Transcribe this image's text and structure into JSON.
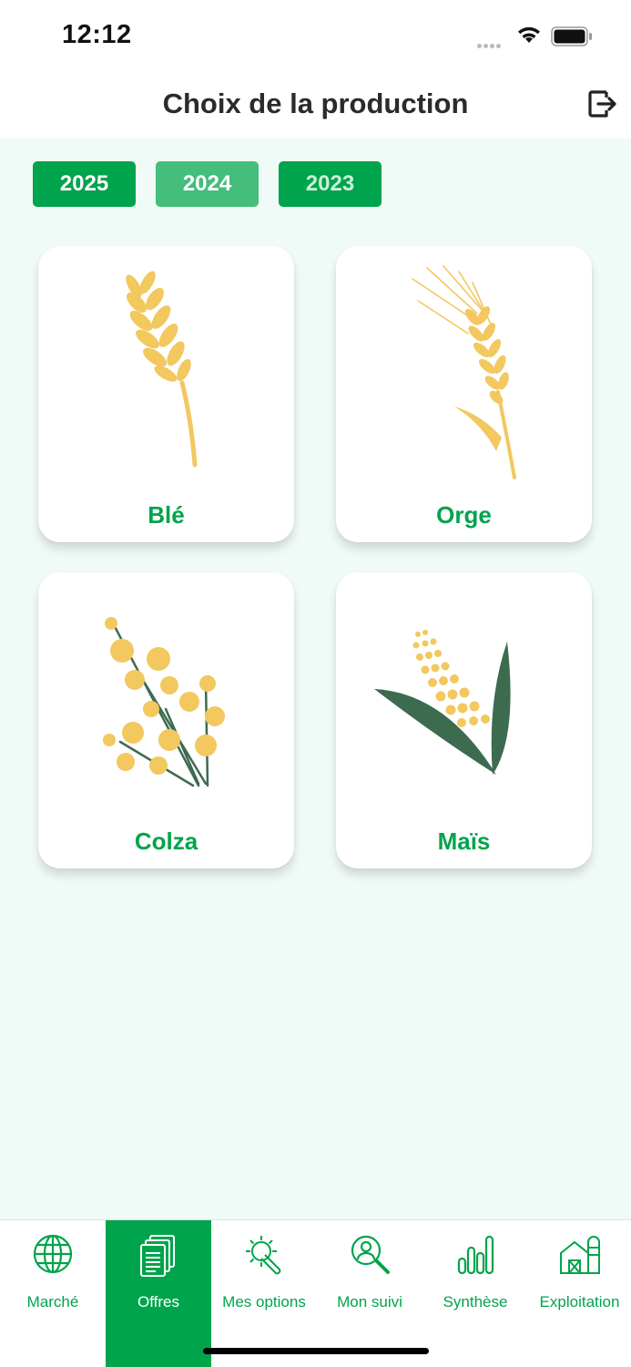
{
  "status": {
    "time": "12:12"
  },
  "header": {
    "title": "Choix de la production"
  },
  "years": [
    "2025",
    "2024",
    "2023"
  ],
  "selected_year": "2024",
  "crops": [
    {
      "label": "Blé",
      "icon": "wheat-icon"
    },
    {
      "label": "Orge",
      "icon": "barley-icon"
    },
    {
      "label": "Colza",
      "icon": "rapeseed-icon"
    },
    {
      "label": "Maïs",
      "icon": "corn-icon"
    }
  ],
  "tabs": [
    {
      "label": "Marché",
      "icon": "globe-icon"
    },
    {
      "label": "Offres",
      "icon": "documents-icon",
      "active": true
    },
    {
      "label": "Mes options",
      "icon": "gear-wrench-icon"
    },
    {
      "label": "Mon suivi",
      "icon": "search-user-icon"
    },
    {
      "label": "Synthèse",
      "icon": "bar-chart-icon"
    },
    {
      "label": "Exploitation",
      "icon": "farm-icon"
    }
  ],
  "colors": {
    "accent": "#00a44c",
    "accent_light": "#45bd7b",
    "grain": "#f2c85f",
    "leaf": "#3d6b4f",
    "background": "#f0faf6"
  }
}
